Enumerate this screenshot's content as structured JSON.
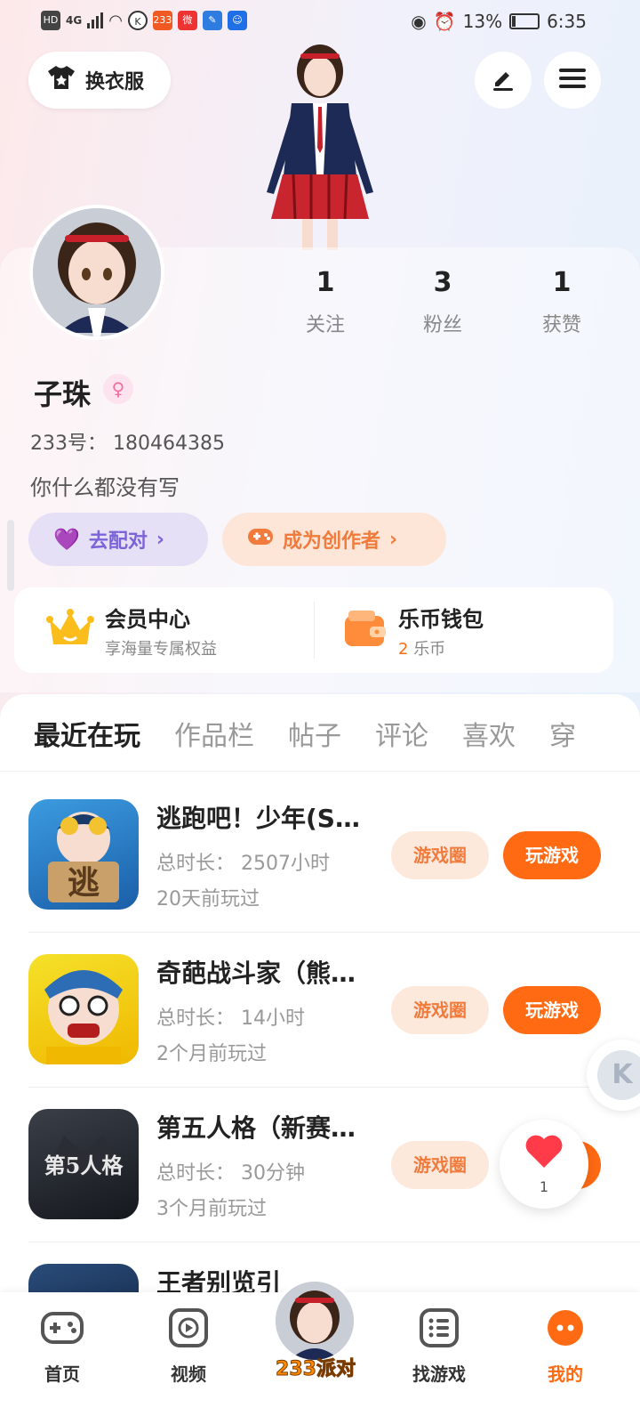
{
  "status_bar": {
    "network": "4G",
    "battery": "13%",
    "time": "6:35",
    "left_icons": [
      "HD",
      "233"
    ]
  },
  "top": {
    "dress_label": "换衣服"
  },
  "profile": {
    "stats": [
      {
        "num": "1",
        "label": "关注"
      },
      {
        "num": "3",
        "label": "粉丝"
      },
      {
        "num": "1",
        "label": "获赞"
      }
    ],
    "name": "子珠",
    "gender_icon": "♀",
    "uid": "233号： 180464385",
    "bio": "你什么都没有写",
    "match_label": "去配对",
    "creator_label": "成为创作者"
  },
  "vip": {
    "member_title": "会员中心",
    "member_sub": "享海量专属权益",
    "wallet_title": "乐币钱包",
    "wallet_count": "2",
    "wallet_unit": "乐币"
  },
  "tabs": [
    "最近在玩",
    "作品栏",
    "帖子",
    "评论",
    "喜欢",
    "穿"
  ],
  "games": [
    {
      "title": "逃跑吧！少年(S…",
      "duration": "总时长： 2507小时",
      "last_played": "20天前玩过",
      "icon_text": "逃",
      "circle_label": "游戏圈",
      "play_label": "玩游戏",
      "icon_colors": [
        "#3c9be0",
        "#1a5fa8"
      ]
    },
    {
      "title": "奇葩战斗家（熊…",
      "duration": "总时长： 14小时",
      "last_played": "2个月前玩过",
      "icon_text": "",
      "circle_label": "游戏圈",
      "play_label": "玩游戏",
      "icon_colors": [
        "#f5e12a",
        "#f0b800"
      ]
    },
    {
      "title": "第五人格（新赛…",
      "duration": "总时长： 30分钟",
      "last_played": "3个月前玩过",
      "icon_text": "第5人格",
      "circle_label": "游戏圈",
      "play_label": "玩游戏",
      "icon_colors": [
        "#3a3f48",
        "#15181d"
      ]
    },
    {
      "title": "王者别览引",
      "duration": "",
      "last_played": "",
      "icon_text": "",
      "circle_label": "",
      "play_label": "",
      "icon_colors": [
        "#2a4c7a",
        "#0f1f3a"
      ]
    }
  ],
  "like": {
    "count": "1"
  },
  "nav": [
    {
      "label": "首页"
    },
    {
      "label": "视频"
    },
    {
      "label": "233派对"
    },
    {
      "label": "找游戏"
    },
    {
      "label": "我的"
    }
  ],
  "colors": {
    "accent": "#ff6a13",
    "match_bg": "#e6e0f6",
    "match_text": "#7c64d8",
    "creator_bg": "#fde6d8",
    "creator_text": "#f07b3c"
  }
}
